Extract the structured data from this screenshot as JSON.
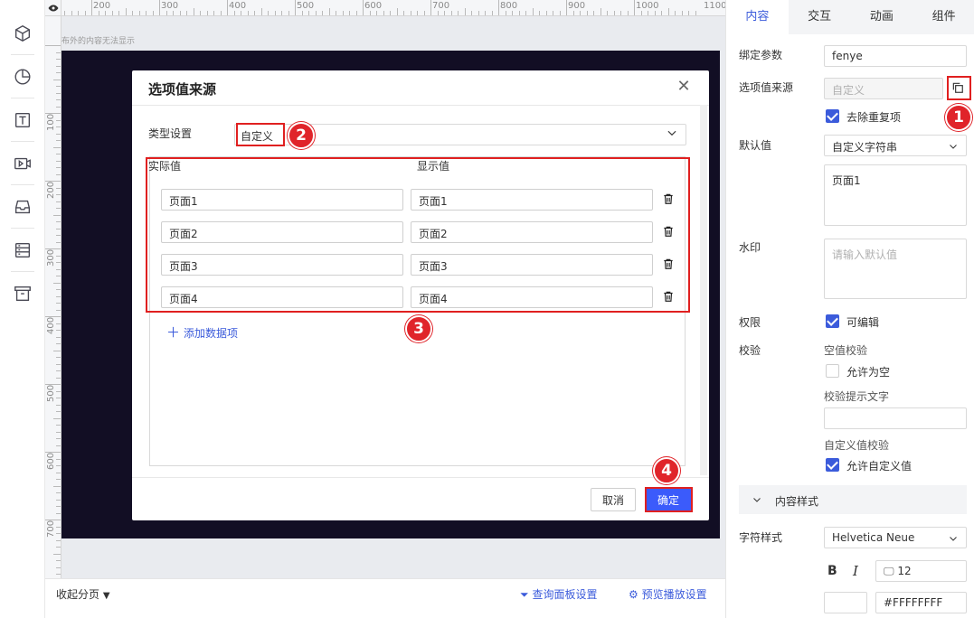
{
  "canvas": {
    "ruler_top_labels": [
      "200",
      "300",
      "400",
      "500",
      "600",
      "700",
      "800",
      "900",
      "1000",
      "1100"
    ],
    "ruler_left_labels": [
      "100",
      "200",
      "300",
      "400",
      "500",
      "600",
      "700"
    ],
    "outside_note": "布外的内容无法显示"
  },
  "modal": {
    "title": "选项值来源",
    "type_label": "类型设置",
    "type_value": "自定义",
    "col_actual": "实际值",
    "col_display": "显示值",
    "rows": [
      {
        "actual": "页面1",
        "display": "页面1"
      },
      {
        "actual": "页面2",
        "display": "页面2"
      },
      {
        "actual": "页面3",
        "display": "页面3"
      },
      {
        "actual": "页面4",
        "display": "页面4"
      }
    ],
    "add_item": "添加数据项",
    "cancel": "取消",
    "ok": "确定"
  },
  "badges": [
    "1",
    "2",
    "3",
    "4"
  ],
  "bottom": {
    "collapse": "收起分页",
    "query_settings": "查询面板设置",
    "preview_settings": "预览播放设置"
  },
  "panel": {
    "tabs": [
      "内容",
      "交互",
      "动画",
      "组件"
    ],
    "bind_label": "绑定参数",
    "bind_value": "fenye",
    "source_label": "选项值来源",
    "source_value": "自定义",
    "dedupe_label": "去除重复项",
    "default_label": "默认值",
    "default_type": "自定义字符串",
    "default_value": "页面1",
    "watermark_label": "水印",
    "watermark_placeholder": "请输入默认值",
    "perm_label": "权限",
    "editable_label": "可编辑",
    "validate_label": "校验",
    "empty_check": "空值校验",
    "allow_empty": "允许为空",
    "hint_text_label": "校验提示文字",
    "custom_check": "自定义值校验",
    "allow_custom": "允许自定义值",
    "section_title": "内容样式",
    "font_label": "字符样式",
    "font_value": "Helvetica Neue",
    "bold": "B",
    "italic": "I",
    "font_size": "12",
    "color_value": "#FFFFFFFF"
  },
  "colors": {
    "accent": "#3b5bdb",
    "highlight": "#e02020",
    "canvas_dark": "#120e24"
  }
}
